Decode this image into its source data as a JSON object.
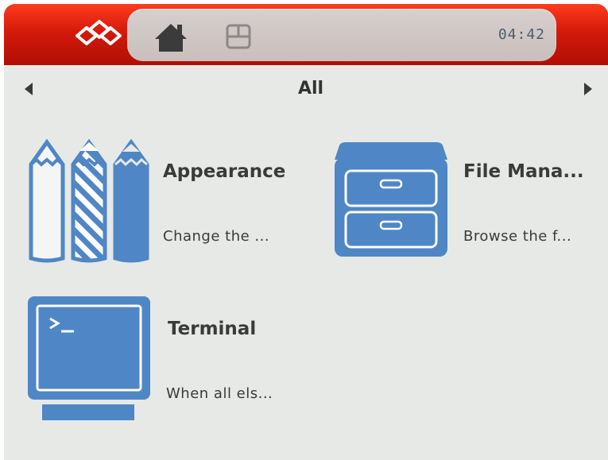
{
  "header": {
    "clock": "04:42",
    "colors": {
      "bar": "#d41a0a",
      "panel": "#cfc6c4",
      "clock_text": "#4a5e6e"
    }
  },
  "category": {
    "title": "All"
  },
  "apps": [
    {
      "name": "Appearance",
      "description": "Change the ...",
      "icon": "pencils-icon"
    },
    {
      "name": "File Mana...",
      "description": "Browse the f...",
      "icon": "file-cabinet-icon"
    },
    {
      "name": "Terminal",
      "description": "When all els...",
      "icon": "terminal-icon"
    }
  ],
  "accent_color": "#4f86c6"
}
